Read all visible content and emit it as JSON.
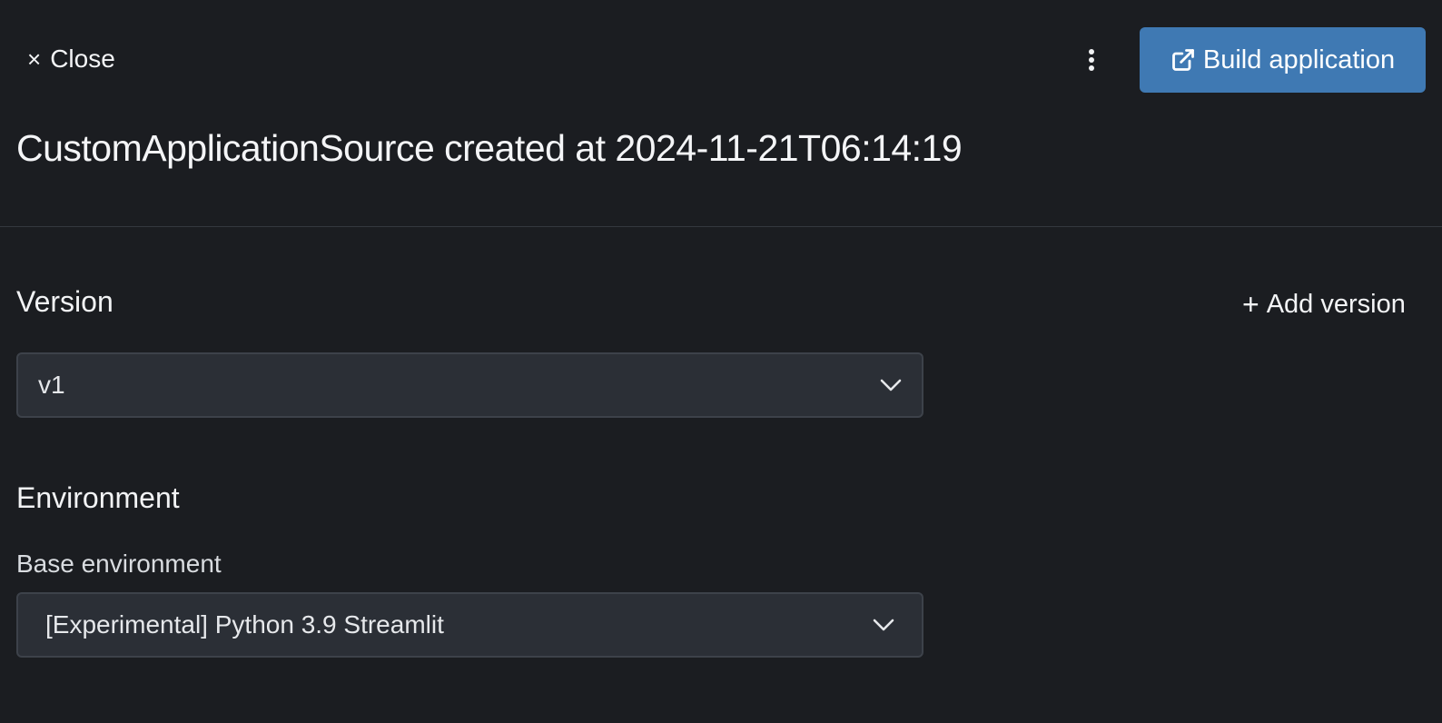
{
  "header": {
    "close_label": "Close",
    "close_icon": "×",
    "more_icon": "kebab-vertical",
    "build_label": "Build application",
    "build_icon": "external-link"
  },
  "title": "CustomApplicationSource created at 2024-11-21T06:14:19",
  "version": {
    "heading": "Version",
    "add_label": "Add version",
    "add_icon": "+",
    "selected": "v1"
  },
  "environment": {
    "heading": "Environment",
    "base_label": "Base environment",
    "selected": "[Experimental] Python 3.9 Streamlit"
  },
  "colors": {
    "background": "#1b1d21",
    "primary_button": "#3f79b3",
    "select_background": "#2b2f36",
    "divider": "#34383f"
  }
}
